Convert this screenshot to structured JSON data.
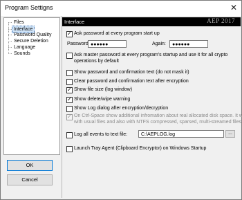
{
  "window": {
    "title": "Program Settigns",
    "close_glyph": "✕"
  },
  "sidebar": {
    "items": [
      {
        "label": "Files",
        "selected": false
      },
      {
        "label": "Interface",
        "selected": true
      },
      {
        "label": "Password Quality",
        "selected": false
      },
      {
        "label": "Secure Deletion",
        "selected": false
      },
      {
        "label": "Language",
        "selected": false
      },
      {
        "label": "Sounds",
        "selected": false
      }
    ]
  },
  "buttons": {
    "ok": "OK",
    "cancel": "Cancel"
  },
  "panel": {
    "title": "Interface",
    "brand": "AEP 2017",
    "ask_password": {
      "label": "Ask password at every program start up",
      "checked": true
    },
    "password_label": "Password:",
    "password_value": "●●●●●●",
    "again_label": "Again:",
    "again_value": "●●●●●●",
    "ask_master": {
      "line1": "Ask master password at every program's startup and use it for all crypto",
      "line2": "operations by default",
      "checked": false
    },
    "show_password": {
      "label": "Show password and confirmation text (do not mask it)",
      "checked": false
    },
    "clear_password": {
      "label": "Clear password and confirmation text after encryption",
      "checked": false
    },
    "show_filesize": {
      "label": "Show file size (log window)",
      "checked": true
    },
    "show_delete_warning": {
      "label": "Show delete/wipe warning",
      "checked": true
    },
    "show_log_dialog": {
      "label": "Show Log dialog after encryption/decryption",
      "checked": false
    },
    "ctrl_space": {
      "line1": "On Ctrl-Space show additional infromation about real allocated disk space. It works",
      "line2": "with usual files and also with NTFS compressed, sparsed, multi-streamed files",
      "checked": true,
      "disabled": true
    },
    "log_events": {
      "label": "Log all events to text file:",
      "checked": false
    },
    "log_path": "C:\\AEPLOG.log",
    "browse_label": "...",
    "launch_tray": {
      "label": "Launch Tray Agent (Clipboard Encryptor) on Windows Startup",
      "checked": false
    }
  }
}
